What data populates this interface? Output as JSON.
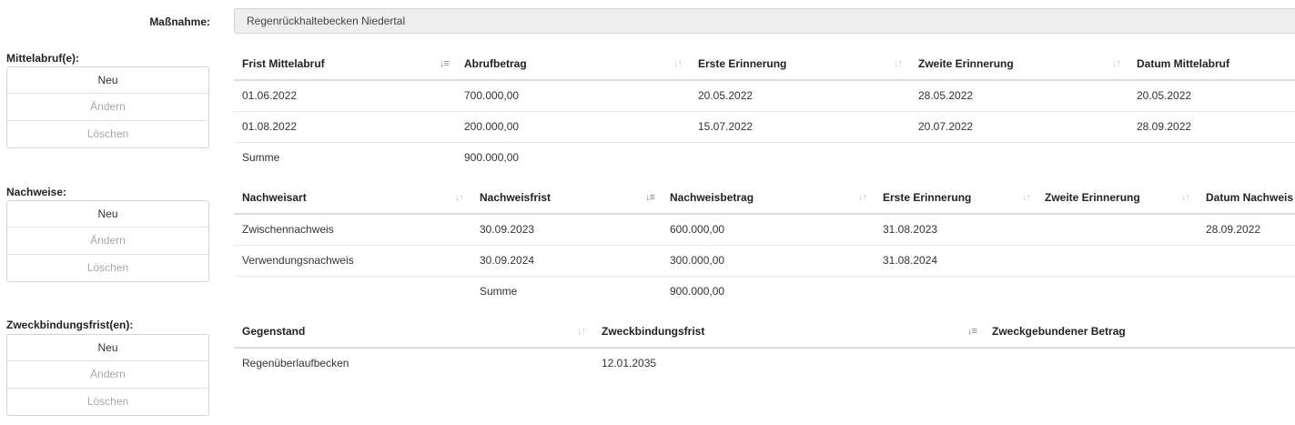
{
  "header": {
    "label": "Maßnahme:",
    "value": "Regenrückhaltebecken Niedertal"
  },
  "sections": {
    "mittelabruf": {
      "label": "Mittelabruf(e):",
      "buttons": {
        "new": "Neu",
        "edit": "Ändern",
        "delete": "Löschen"
      },
      "columns": [
        "Frist Mittelabruf",
        "Abrufbetrag",
        "Erste Erinnerung",
        "Zweite Erinnerung",
        "Datum Mittelabruf"
      ],
      "rows": [
        [
          "01.06.2022",
          "700.000,00",
          "20.05.2022",
          "28.05.2022",
          "20.05.2022"
        ],
        [
          "01.08.2022",
          "200.000,00",
          "15.07.2022",
          "20.07.2022",
          "28.09.2022"
        ]
      ],
      "sum_label": "Summe",
      "sum_value": "900.000,00"
    },
    "nachweise": {
      "label": "Nachweise:",
      "buttons": {
        "new": "Neu",
        "edit": "Ändern",
        "delete": "Löschen"
      },
      "columns": [
        "Nachweisart",
        "Nachweisfrist",
        "Nachweisbetrag",
        "Erste Erinnerung",
        "Zweite Erinnerung",
        "Datum Nachweis"
      ],
      "rows": [
        [
          "Zwischennachweis",
          "30.09.2023",
          "600.000,00",
          "31.08.2023",
          "",
          "28.09.2022"
        ],
        [
          "Verwendungsnachweis",
          "30.09.2024",
          "300.000,00",
          "31.08.2024",
          "",
          ""
        ]
      ],
      "sum_label": "Summe",
      "sum_value": "900.000,00"
    },
    "zweckbindung": {
      "label": "Zweckbindungsfrist(en):",
      "buttons": {
        "new": "Neu",
        "edit": "Ändern",
        "delete": "Löschen"
      },
      "columns": [
        "Gegenstand",
        "Zweckbindungsfrist",
        "Zweckgebundener Betrag"
      ],
      "rows": [
        [
          "Regenüberlaufbecken",
          "12.01.2035",
          ""
        ]
      ]
    }
  },
  "icons": {
    "sort": "sort-both-icon",
    "sort_active": "sort-ascending-icon"
  }
}
